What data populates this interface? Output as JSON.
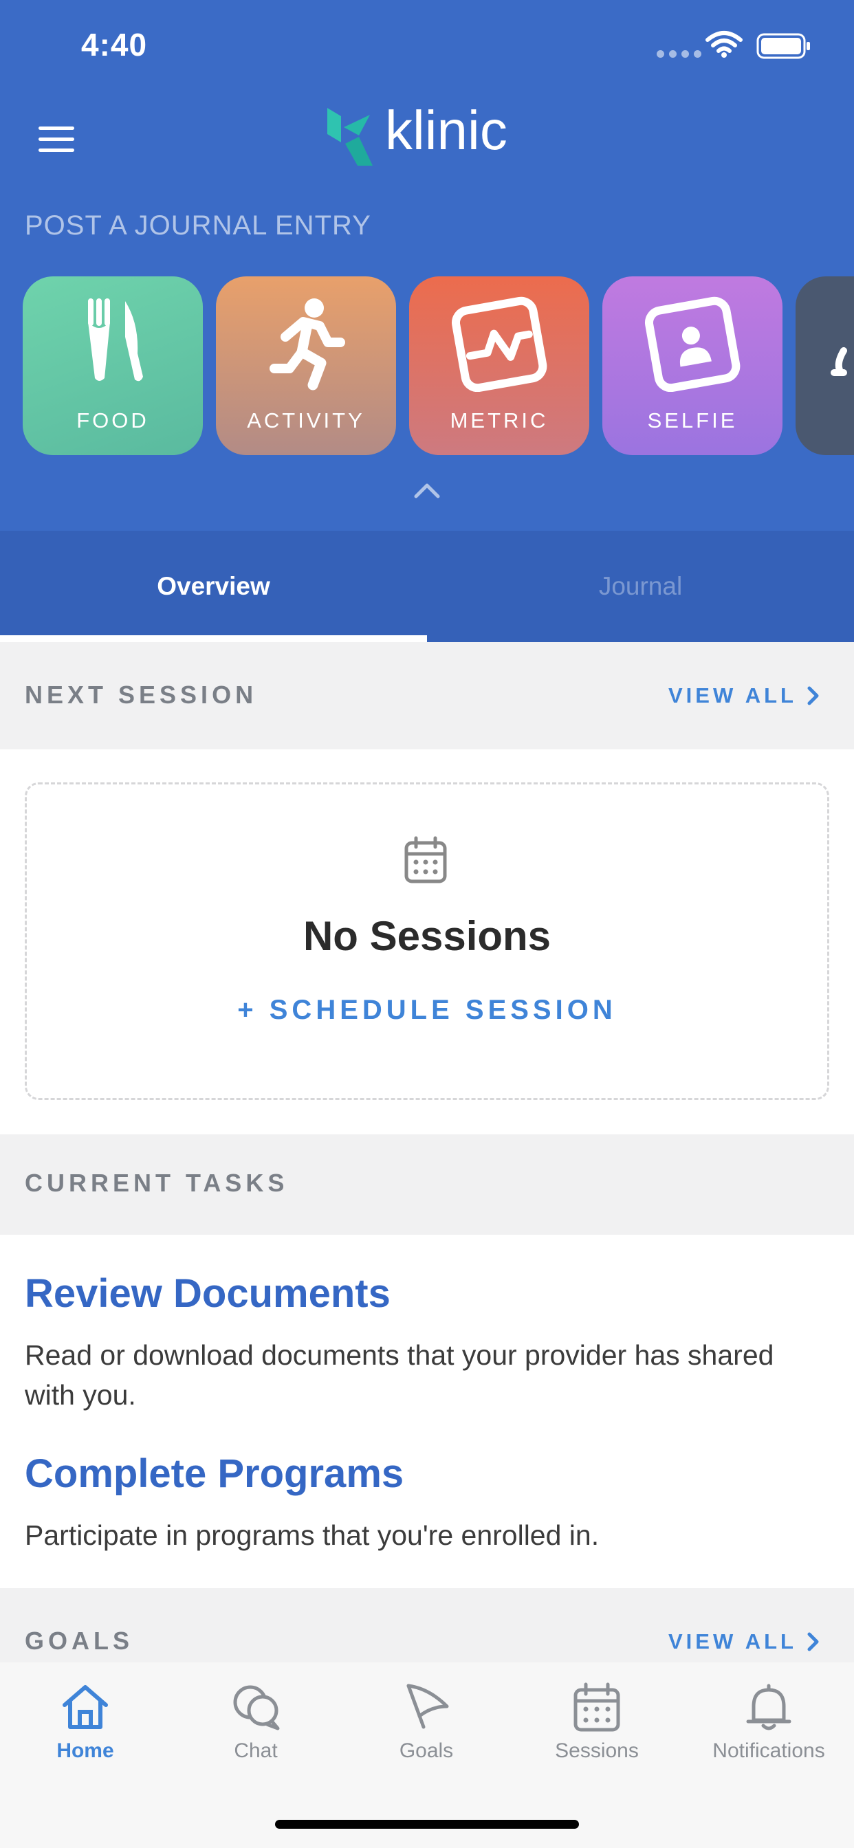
{
  "status": {
    "time": "4:40"
  },
  "app": {
    "name": "klinic",
    "brand_color": "#3b6bc6",
    "accent": "#3f84d8"
  },
  "journal": {
    "label": "POST A JOURNAL ENTRY",
    "tiles": [
      {
        "label": "FOOD",
        "icon": "fork-knife-icon"
      },
      {
        "label": "ACTIVITY",
        "icon": "running-person-icon"
      },
      {
        "label": "METRIC",
        "icon": "chart-line-icon"
      },
      {
        "label": "SELFIE",
        "icon": "selfie-icon"
      },
      {
        "label": "",
        "icon": "partial-tile-icon"
      }
    ]
  },
  "tabs": [
    {
      "label": "Overview",
      "active": true
    },
    {
      "label": "Journal",
      "active": false
    }
  ],
  "next_session": {
    "title": "NEXT SESSION",
    "view_all": "VIEW ALL",
    "empty_title": "No Sessions",
    "schedule_label": "+ SCHEDULE SESSION"
  },
  "tasks": {
    "title": "CURRENT TASKS",
    "items": [
      {
        "title": "Review Documents",
        "description": "Read or download documents that your provider has shared with you."
      },
      {
        "title": "Complete Programs",
        "description": "Participate in programs that you're enrolled in."
      }
    ]
  },
  "goals": {
    "title": "GOALS",
    "view_all": "VIEW ALL"
  },
  "nav": [
    {
      "label": "Home",
      "icon": "home-icon",
      "active": true
    },
    {
      "label": "Chat",
      "icon": "chat-icon",
      "active": false
    },
    {
      "label": "Goals",
      "icon": "flag-icon",
      "active": false
    },
    {
      "label": "Sessions",
      "icon": "calendar-icon",
      "active": false
    },
    {
      "label": "Notifications",
      "icon": "bell-icon",
      "active": false
    }
  ]
}
